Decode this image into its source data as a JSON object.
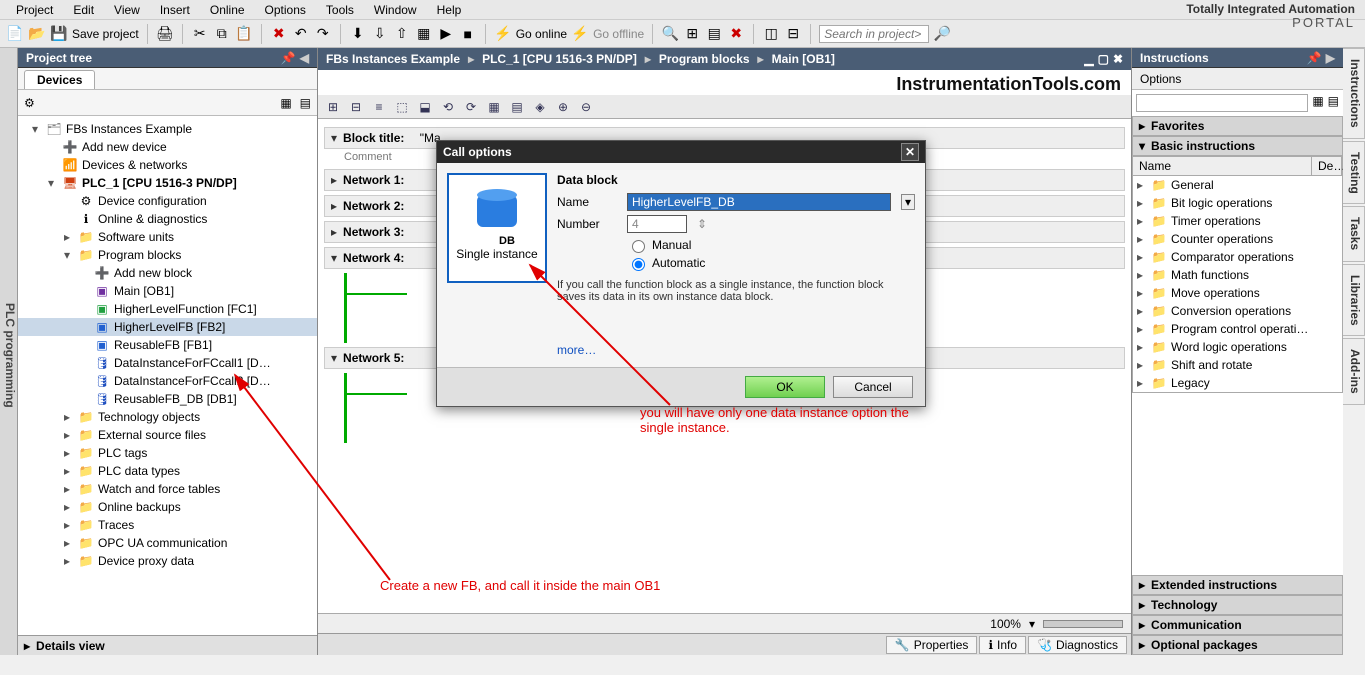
{
  "brand": {
    "line1": "Totally Integrated Automation",
    "line2": "PORTAL"
  },
  "menu": {
    "items": [
      "Project",
      "Edit",
      "View",
      "Insert",
      "Online",
      "Options",
      "Tools",
      "Window",
      "Help"
    ]
  },
  "maintb": {
    "save": "Save project",
    "goonline": "Go online",
    "gooffline": "Go offline",
    "search_ph": "Search in project>"
  },
  "left": {
    "title": "Project tree",
    "tab": "Devices",
    "tree": {
      "root": "FBs Instances Example",
      "add_device": "Add new device",
      "dev_net": "Devices & networks",
      "plc": "PLC_1 [CPU 1516-3 PN/DP]",
      "devcfg": "Device configuration",
      "online": "Online & diagnostics",
      "swunits": "Software units",
      "progblocks": "Program blocks",
      "addblock": "Add new block",
      "main": "Main [OB1]",
      "fc1": "HigherLevelFunction [FC1]",
      "fb2": "HigherLevelFB [FB2]",
      "fb1": "ReusableFB [FB1]",
      "db1": "DataInstanceForFCcall1 [D…",
      "db2": "DataInstanceForFCcall2 [D…",
      "db3": "ReusableFB_DB [DB1]",
      "tech": "Technology objects",
      "ext": "External source files",
      "tags": "PLC tags",
      "types": "PLC data types",
      "watch": "Watch and force tables",
      "backup": "Online backups",
      "traces": "Traces",
      "opc": "OPC UA communication",
      "proxy": "Device proxy data"
    },
    "details": "Details view",
    "vtab": "PLC programming"
  },
  "center": {
    "bc": [
      "FBs Instances Example",
      "PLC_1 [CPU 1516-3 PN/DP]",
      "Program blocks",
      "Main [OB1]"
    ],
    "watermark": "InstrumentationTools.com",
    "blocktitle": "Block title:",
    "blocktitle_val": "\"Ma…",
    "comment": "Comment",
    "net1": "Network 1:",
    "net2": "Network 2:",
    "net3": "Network 3:",
    "net4": "Network 4:",
    "net5": "Network 5:",
    "zoom": "100%",
    "tabs": {
      "props": "Properties",
      "info": "Info",
      "diag": "Diagnostics"
    }
  },
  "right": {
    "title": "Instructions",
    "options": "Options",
    "fav": "Favorites",
    "basic": "Basic instructions",
    "col_name": "Name",
    "col_desc": "De…",
    "items": [
      "General",
      "Bit logic operations",
      "Timer operations",
      "Counter operations",
      "Comparator operations",
      "Math functions",
      "Move operations",
      "Conversion operations",
      "Program control operati…",
      "Word logic operations",
      "Shift and rotate",
      "Legacy"
    ],
    "ext": "Extended instructions",
    "tech": "Technology",
    "comm": "Communication",
    "opt": "Optional packages",
    "vtabs": [
      "Instructions",
      "Testing",
      "Tasks",
      "Libraries",
      "Add-ins"
    ]
  },
  "dialog": {
    "title": "Call options",
    "single": "Single instance",
    "dbhead": "Data block",
    "name_lbl": "Name",
    "name_val": "HigherLevelFB_DB",
    "num_lbl": "Number",
    "num_val": "4",
    "manual": "Manual",
    "auto": "Automatic",
    "desc": "If you call the function block as a single instance, the function block saves its data in its own instance data block.",
    "more": "more…",
    "ok": "OK",
    "cancel": "Cancel"
  },
  "anno": {
    "a1": "you will have only one data instance option the single instance.",
    "a2": "Create a new FB, and call it inside the main OB1"
  }
}
